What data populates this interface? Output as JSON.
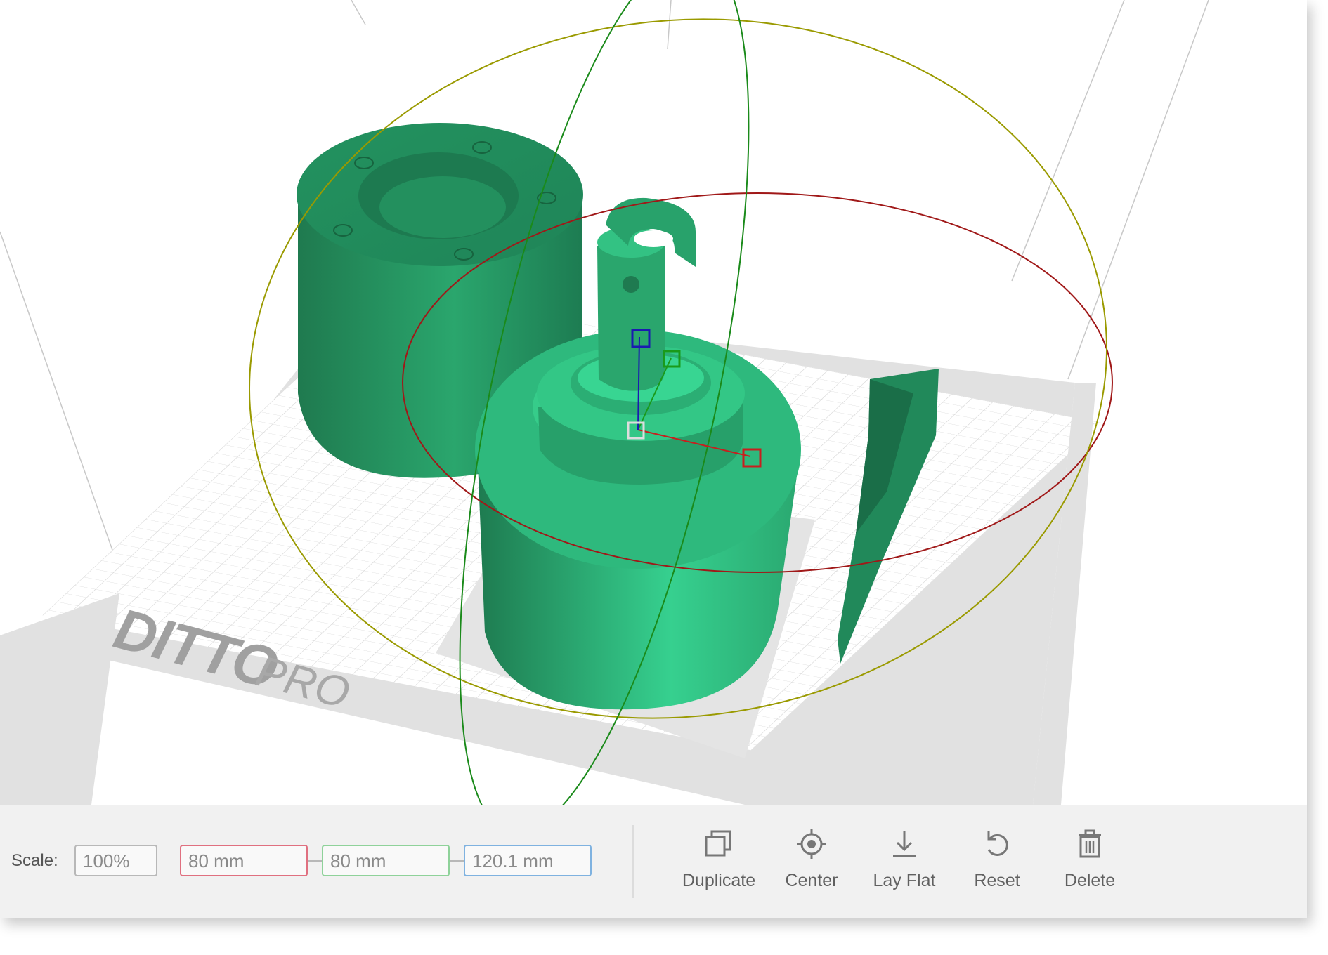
{
  "toolbar": {
    "scale_label": "Scale:",
    "scale_value": "100%",
    "x_value": "80 mm",
    "y_value": "80 mm",
    "z_value": "120.1 mm",
    "actions": [
      {
        "label": "Duplicate",
        "icon": "duplicate-icon"
      },
      {
        "label": "Center",
        "icon": "target-icon"
      },
      {
        "label": "Lay Flat",
        "icon": "download-arrow-icon"
      },
      {
        "label": "Reset",
        "icon": "undo-icon"
      },
      {
        "label": "Delete",
        "icon": "trash-icon"
      }
    ]
  },
  "viewport": {
    "logo_text": "DITTO PRO",
    "model_color": "#2eb97d",
    "gizmo_colors": {
      "x": "#c81e1e",
      "y": "#1a9a1a",
      "z": "#1a1ab0",
      "ring_yellow": "#9a9a00",
      "ring_red": "#a01818",
      "ring_green": "#1a8a1a"
    }
  }
}
